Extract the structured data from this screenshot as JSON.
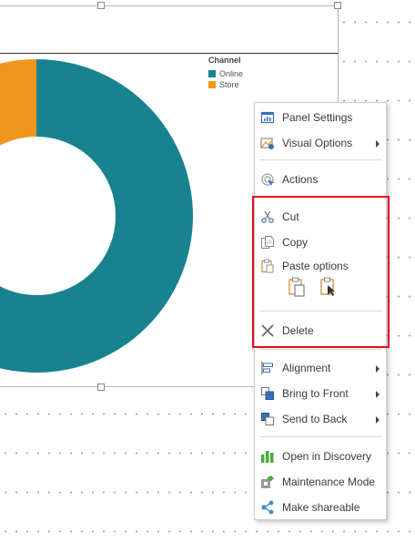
{
  "chart": {
    "legend_title": "Channel",
    "legend": [
      {
        "label": "Online",
        "color": "#18838f"
      },
      {
        "label": "Store",
        "color": "#f0961e"
      }
    ]
  },
  "chart_data": {
    "type": "pie",
    "title": "",
    "legend_title": "Channel",
    "categories": [
      "Online",
      "Store"
    ],
    "values": [
      90,
      10
    ],
    "colors": [
      "#18838f",
      "#f0961e"
    ]
  },
  "menu": {
    "panel_settings": "Panel Settings",
    "visual_options": "Visual Options",
    "actions": "Actions",
    "cut": "Cut",
    "copy": "Copy",
    "paste_options": "Paste options",
    "delete": "Delete",
    "alignment": "Alignment",
    "bring_to_front": "Bring to Front",
    "send_to_back": "Send to Back",
    "open_in_discovery": "Open in Discovery",
    "maintenance_mode": "Maintenance Mode",
    "make_shareable": "Make shareable"
  },
  "icons": {
    "panel_settings": "panel-settings-icon",
    "visual_options": "visual-options-icon",
    "actions": "actions-icon",
    "cut": "scissors-icon",
    "copy": "copy-icon",
    "paste": "paste-icon",
    "delete": "delete-x-icon",
    "alignment": "alignment-icon",
    "bring_to_front": "bring-to-front-icon",
    "send_to_back": "send-to-back-icon",
    "open_in_discovery": "bar-chart-icon",
    "maintenance_mode": "maintenance-icon",
    "make_shareable": "share-icon"
  },
  "colors": {
    "highlight": "#e0101a",
    "accent": "#18838f"
  }
}
